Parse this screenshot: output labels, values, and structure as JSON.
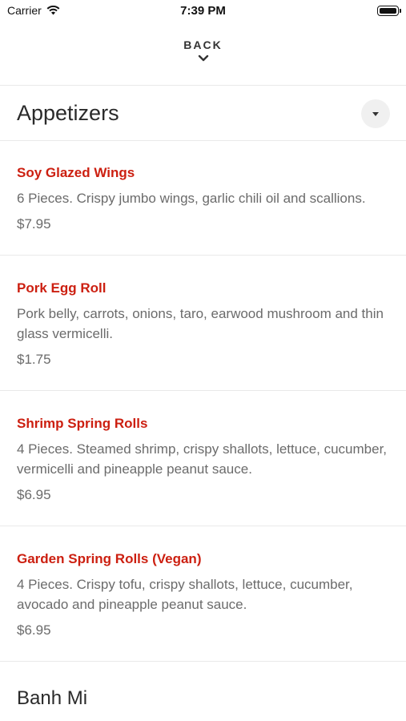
{
  "status_bar": {
    "carrier": "Carrier",
    "time": "7:39 PM"
  },
  "nav": {
    "back_label": "BACK"
  },
  "section": {
    "title": "Appetizers"
  },
  "items": [
    {
      "name": "Soy Glazed Wings",
      "description": "6 Pieces. Crispy jumbo wings, garlic chili oil and scallions.",
      "price": "$7.95"
    },
    {
      "name": "Pork Egg Roll",
      "description": "Pork belly, carrots, onions, taro, earwood mushroom and thin glass vermicelli.",
      "price": "$1.75"
    },
    {
      "name": "Shrimp Spring Rolls",
      "description": "4 Pieces. Steamed shrimp, crispy shallots, lettuce, cucumber, vermicelli and pineapple peanut sauce.",
      "price": "$6.95"
    },
    {
      "name": "Garden Spring Rolls (Vegan)",
      "description": "4 Pieces. Crispy tofu, crispy shallots, lettuce, cucumber, avocado and pineapple peanut sauce.",
      "price": "$6.95"
    }
  ],
  "next_section": {
    "title": "Banh Mi"
  },
  "colors": {
    "accent": "#cc1f10",
    "text_secondary": "#6b6b6b"
  }
}
